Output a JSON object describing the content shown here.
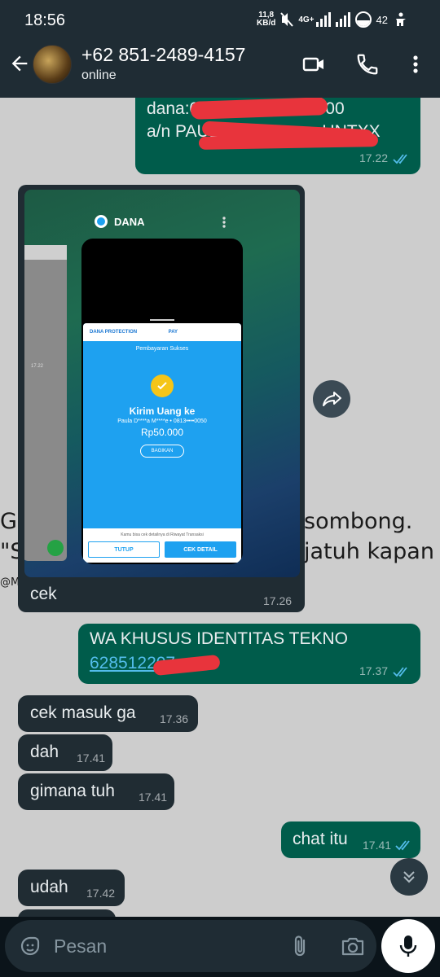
{
  "status_bar": {
    "time": "18:56",
    "net_speed_value": "11,8",
    "net_speed_unit": "KB/d",
    "network": "4G+",
    "battery": "42"
  },
  "header": {
    "contact_name": "+62 851-2489-4157",
    "contact_status": "online",
    "icons": [
      "back-arrow-icon",
      "video-call-icon",
      "voice-call-icon",
      "more-vert-icon"
    ]
  },
  "messages": [
    {
      "dir": "out",
      "line1": "dana:0",
      "line1_tail": "02000",
      "line2": "a/n PAUL XXX",
      "line2_tail": "UNTXX",
      "time": "17.22",
      "ticks": "read"
    },
    {
      "dir": "in",
      "type": "image",
      "caption": "cek",
      "time": "17.26"
    },
    {
      "dir": "out",
      "line1": "WA KHUSUS IDENTITAS TEKNO",
      "link": "628512207",
      "time": "17.37",
      "ticks": "read"
    },
    {
      "dir": "in",
      "text": "cek masuk ga",
      "time": "17.36"
    },
    {
      "dir": "in",
      "text": "dah",
      "time": "17.41"
    },
    {
      "dir": "in",
      "text": "gimana tuh",
      "time": "17.41"
    },
    {
      "dir": "out",
      "text": "chat itu",
      "time": "17.41",
      "ticks": "read"
    },
    {
      "dir": "in",
      "text": "udah",
      "time": "17.42"
    }
  ],
  "screenshot": {
    "app_name": "DANA",
    "protection_label": "DANA PROTECTION",
    "pay_label": "PAY",
    "success_title": "Pembayaran Sukses",
    "send_title": "Kirim Uang ke",
    "recipient": "Paula D****a M****e • 0813••••0050",
    "amount": "Rp50.000",
    "share_button": "BAGIKAN",
    "history_note": "Kamu bisa cek detailnya di Riwayat Transaksi",
    "close_button": "TUTUP",
    "detail_button": "CEK DETAIL",
    "side_time": "17.22"
  },
  "background_text": {
    "line1_left": "G",
    "line1_right": "sombong.",
    "line2_left": "\"S",
    "line2_right": "jatuh kapan",
    "line3_left": "@M"
  },
  "input": {
    "placeholder": "Pesan"
  },
  "colors": {
    "outgoing_bubble": "#005c4b",
    "incoming_bubble": "#202c33",
    "chat_background": "#cdcdcd",
    "read_ticks": "#53bdeb",
    "redaction": "#e8343c"
  }
}
